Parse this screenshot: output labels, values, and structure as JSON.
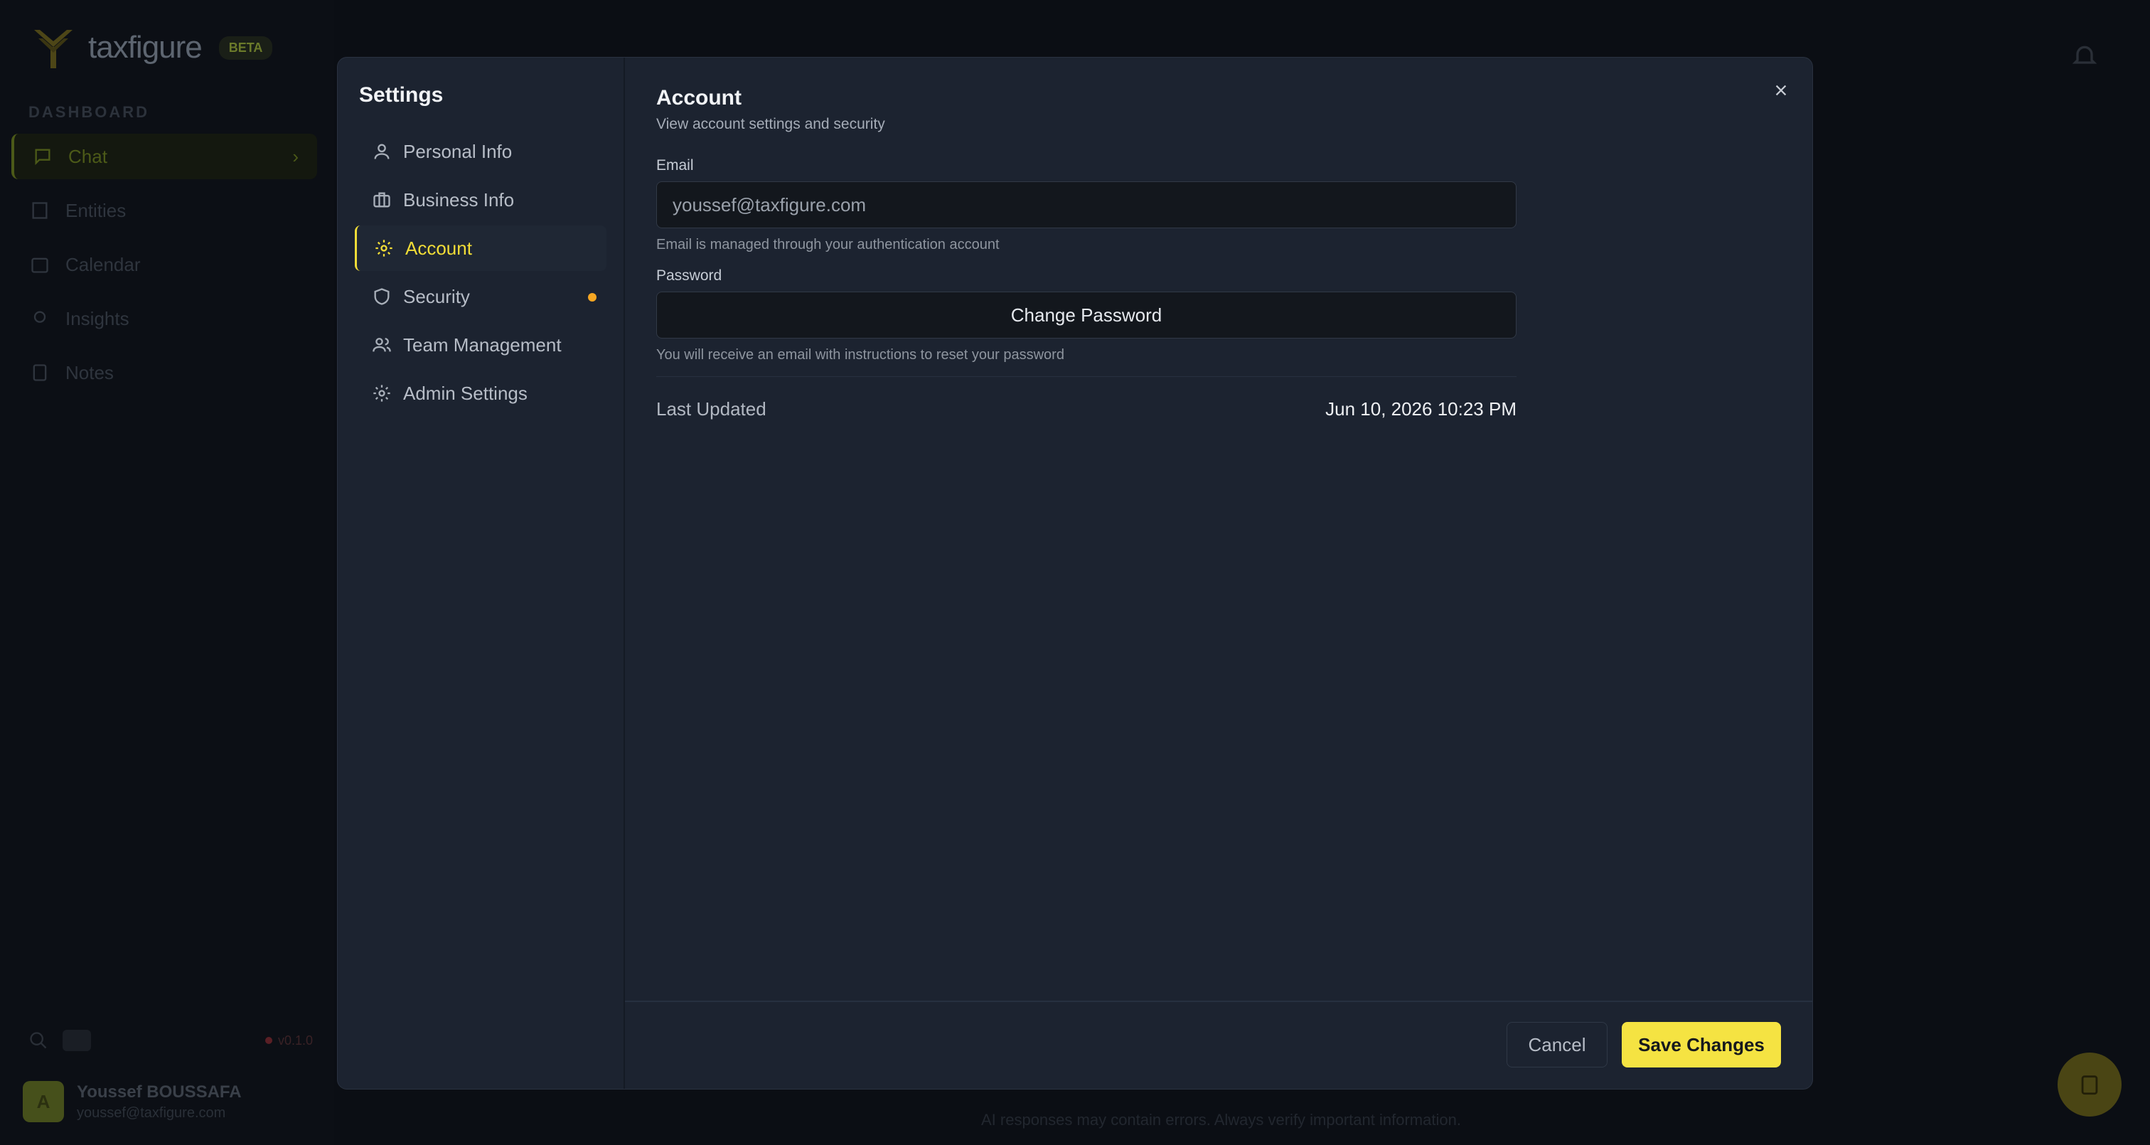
{
  "background": {
    "brand": {
      "name": "taxfigure",
      "badge": "BETA"
    },
    "nav_section": "DASHBOARD",
    "nav_items": [
      {
        "label": "Chat",
        "icon": "chat-icon",
        "active": true
      },
      {
        "label": "Entities",
        "icon": "building-icon"
      },
      {
        "label": "Calendar",
        "icon": "calendar-icon"
      },
      {
        "label": "Insights",
        "icon": "lightbulb-icon"
      },
      {
        "label": "Notes",
        "icon": "note-icon"
      }
    ],
    "version": "v0.1.0",
    "user": {
      "initial": "A",
      "name": "Youssef BOUSSAFA",
      "email": "youssef@taxfigure.com"
    },
    "footer_note": "AI responses may contain errors. Always verify important information."
  },
  "settings": {
    "title": "Settings",
    "nav": [
      {
        "label": "Personal Info",
        "icon": "user-icon"
      },
      {
        "label": "Business Info",
        "icon": "briefcase-icon"
      },
      {
        "label": "Account",
        "icon": "gear-icon",
        "active": true
      },
      {
        "label": "Security",
        "icon": "shield-icon",
        "has_indicator": true
      },
      {
        "label": "Team Management",
        "icon": "users-icon"
      },
      {
        "label": "Admin Settings",
        "icon": "gear-icon"
      }
    ]
  },
  "account": {
    "title": "Account",
    "subtitle": "View account settings and security",
    "email_label": "Email",
    "email_value": "youssef@taxfigure.com",
    "email_helper": "Email is managed through your authentication account",
    "password_label": "Password",
    "change_password_label": "Change Password",
    "password_helper": "You will receive an email with instructions to reset your password",
    "last_updated_label": "Last Updated",
    "last_updated_value": "Jun 10, 2026 10:23 PM"
  },
  "actions": {
    "cancel": "Cancel",
    "save": "Save Changes"
  },
  "colors": {
    "accent": "#f5e342",
    "indicator": "#f5a623",
    "modal_bg": "#1c2330"
  }
}
